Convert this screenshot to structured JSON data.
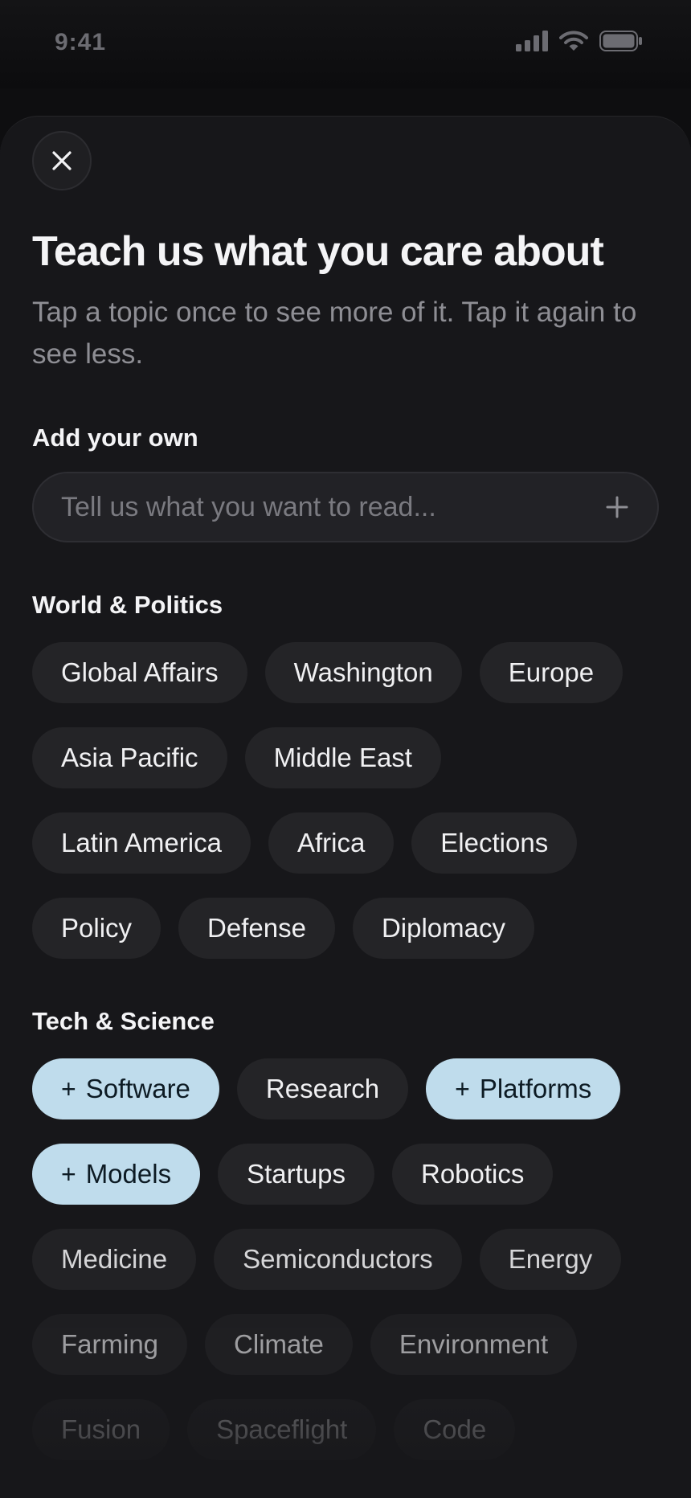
{
  "status_bar": {
    "time": "9:41"
  },
  "sheet": {
    "title": "Teach us what you care about",
    "subtitle": "Tap a topic once to see more of it. Tap it again to see less.",
    "add_own_label": "Add your own",
    "input_placeholder": "Tell us what you want to read...",
    "sections": [
      {
        "label": "World & Politics",
        "topics": [
          {
            "label": "Global Affairs",
            "selected": false
          },
          {
            "label": "Washington",
            "selected": false
          },
          {
            "label": "Europe",
            "selected": false
          },
          {
            "label": "Asia Pacific",
            "selected": false
          },
          {
            "label": "Middle East",
            "selected": false
          },
          {
            "label": "Latin America",
            "selected": false
          },
          {
            "label": "Africa",
            "selected": false
          },
          {
            "label": "Elections",
            "selected": false
          },
          {
            "label": "Policy",
            "selected": false
          },
          {
            "label": "Defense",
            "selected": false
          },
          {
            "label": "Diplomacy",
            "selected": false
          }
        ]
      },
      {
        "label": "Tech & Science",
        "topics": [
          {
            "label": "Software",
            "selected": true
          },
          {
            "label": "Research",
            "selected": false
          },
          {
            "label": "Platforms",
            "selected": true
          },
          {
            "label": "Models",
            "selected": true
          },
          {
            "label": "Startups",
            "selected": false
          },
          {
            "label": "Robotics",
            "selected": false
          },
          {
            "label": "Medicine",
            "selected": false
          },
          {
            "label": "Semiconductors",
            "selected": false
          },
          {
            "label": "Energy",
            "selected": false
          },
          {
            "label": "Farming",
            "selected": false
          },
          {
            "label": "Climate",
            "selected": false
          },
          {
            "label": "Environment",
            "selected": false
          },
          {
            "label": "Fusion",
            "selected": false
          },
          {
            "label": "Spaceflight",
            "selected": false
          },
          {
            "label": "Code",
            "selected": false
          }
        ]
      }
    ]
  },
  "colors": {
    "background": "#17171a",
    "chip": "#242427",
    "chip_selected": "#bfdcec",
    "text_primary": "#f4f4f6",
    "text_secondary": "#8e8e94"
  },
  "icons": {
    "close": "close-icon",
    "add": "plus-icon",
    "signal": "cellular-signal-icon",
    "wifi": "wifi-icon",
    "battery": "battery-icon"
  }
}
